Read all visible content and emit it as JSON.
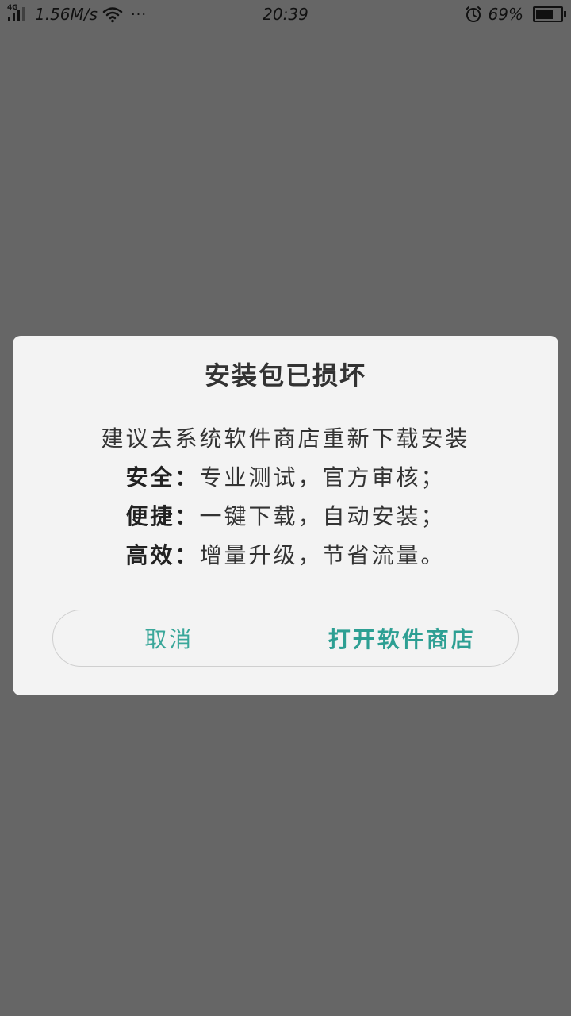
{
  "status_bar": {
    "network_type": "4G",
    "speed": "1.56M/s",
    "more": "···",
    "time": "20:39",
    "battery_percent": "69%",
    "battery_level": 0.69,
    "icons": [
      "signal-icon",
      "wifi-icon",
      "alarm-icon",
      "battery-icon"
    ]
  },
  "dialog": {
    "title": "安装包已损坏",
    "lines": [
      {
        "text": "建议去系统软件商店重新下载安装"
      },
      {
        "label": "安全：",
        "text": "专业测试，官方审核；"
      },
      {
        "label": "便捷：",
        "text": "一键下载，自动安装；"
      },
      {
        "label": "高效：",
        "text": "增量升级，节省流量。"
      }
    ],
    "cancel_label": "取消",
    "confirm_label": "打开软件商店"
  },
  "colors": {
    "scrim": "#666666",
    "dialog_bg": "#f3f3f3",
    "accent": "#3aa79a"
  }
}
